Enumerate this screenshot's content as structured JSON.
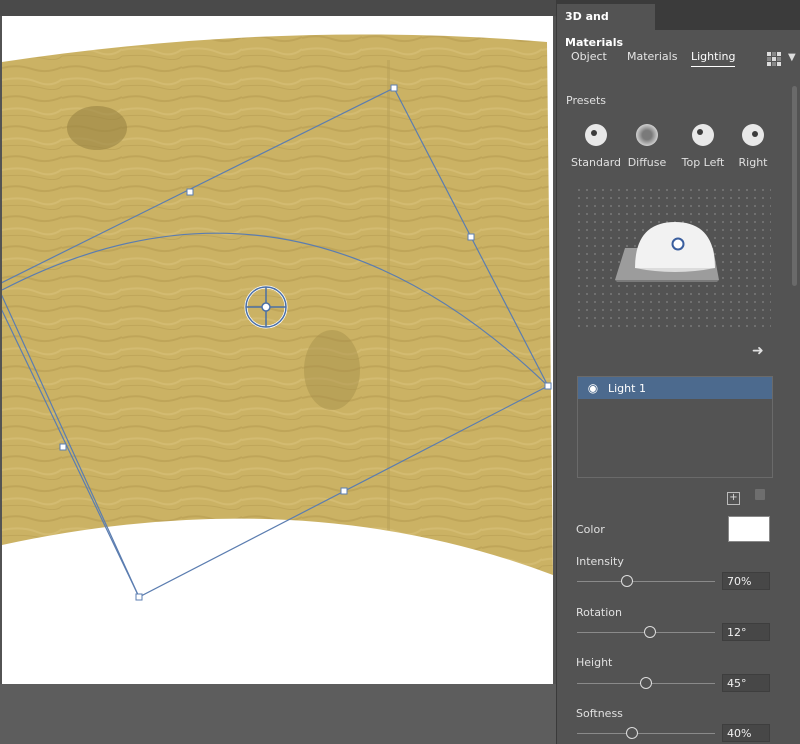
{
  "panel": {
    "title": "3D and Materials",
    "tabs": [
      {
        "label": "Object"
      },
      {
        "label": "Materials"
      },
      {
        "label": "Lighting",
        "active": true
      }
    ],
    "presets_label": "Presets",
    "presets": [
      {
        "label": "Standard"
      },
      {
        "label": "Diffuse"
      },
      {
        "label": "Top Left"
      },
      {
        "label": "Right"
      }
    ],
    "lights": [
      {
        "name": "Light 1",
        "selected": true
      }
    ],
    "properties": {
      "color_label": "Color",
      "color_value": "#ffffff",
      "intensity": {
        "label": "Intensity",
        "value": "70%",
        "fraction": 0.36
      },
      "rotation": {
        "label": "Rotation",
        "value": "12°",
        "fraction": 0.53
      },
      "height": {
        "label": "Height",
        "value": "45°",
        "fraction": 0.5
      },
      "softness": {
        "label": "Softness",
        "value": "40%",
        "fraction": 0.4
      }
    }
  },
  "colors": {
    "panel_bg": "#535353",
    "selected_row": "#4c6a8e",
    "texture": "#c9b060",
    "selection": "#4a6fa5"
  }
}
